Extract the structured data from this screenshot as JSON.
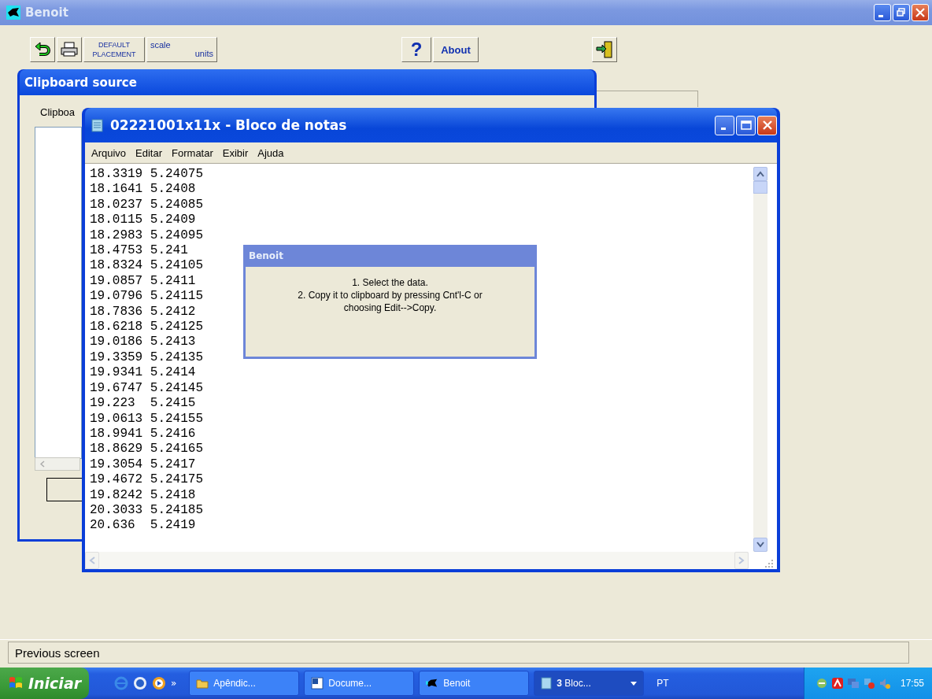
{
  "main_window": {
    "title": "Benoit",
    "toolbar": {
      "default_placement": [
        "DEFAULT",
        "PLACEMENT"
      ],
      "scale_units": {
        "top": "scale",
        "bottom": "units"
      },
      "help": "?",
      "about": "About"
    },
    "status_bar": "Previous screen"
  },
  "clipboard_window": {
    "title": "Clipboard source",
    "label": "Clipboa"
  },
  "notepad": {
    "title": "02221001x11x - Bloco de notas",
    "menu": [
      "Arquivo",
      "Editar",
      "Formatar",
      "Exibir",
      "Ajuda"
    ],
    "lines": [
      "18.3319 5.24075",
      "18.1641 5.2408",
      "18.0237 5.24085",
      "18.0115 5.2409",
      "18.2983 5.24095",
      "18.4753 5.241",
      "18.8324 5.24105",
      "19.0857 5.2411",
      "19.0796 5.24115",
      "18.7836 5.2412",
      "18.6218 5.24125",
      "19.0186 5.2413",
      "19.3359 5.24135",
      "19.9341 5.2414",
      "19.6747 5.24145",
      "19.223  5.2415",
      "19.0613 5.24155",
      "18.9941 5.2416",
      "18.8629 5.24165",
      "19.3054 5.2417",
      "19.4672 5.24175",
      "19.8242 5.2418",
      "20.3033 5.24185",
      "20.636  5.2419"
    ]
  },
  "dialog": {
    "title": "Benoit",
    "message": "1. Select the data.\n2. Copy it to clipboard by pressing Cnt'l-C or\nchoosing Edit-->Copy."
  },
  "taskbar": {
    "start": "Iniciar",
    "overflow": "»",
    "tasks": [
      {
        "kind": "folder",
        "label": "Apêndic...",
        "selected": false
      },
      {
        "kind": "word",
        "label": "Docume...",
        "selected": false
      },
      {
        "kind": "benoit",
        "label": "Benoit",
        "selected": false
      },
      {
        "kind": "notepad",
        "label": "**3** Bloc...",
        "selected": true
      }
    ],
    "language": "PT",
    "clock": "17:55"
  }
}
